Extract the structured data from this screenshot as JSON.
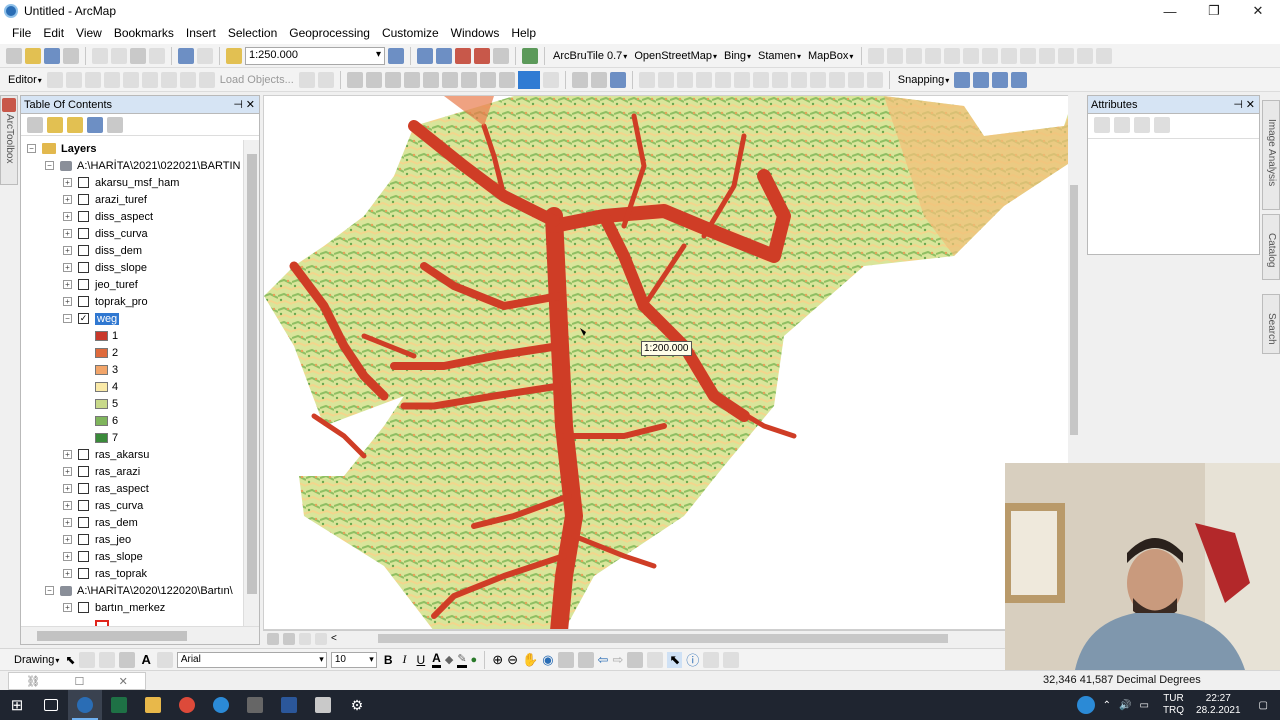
{
  "window": {
    "title": "Untitled - ArcMap",
    "minimize": "—",
    "restore": "❐",
    "close": "✕"
  },
  "menu": [
    "File",
    "Edit",
    "View",
    "Bookmarks",
    "Insert",
    "Selection",
    "Geoprocessing",
    "Customize",
    "Windows",
    "Help"
  ],
  "toolbar": {
    "scale": "1:250.000",
    "arcbrutile": "ArcBruTile 0.7",
    "openstreetmap": "OpenStreetMap",
    "bing": "Bing",
    "stamen": "Stamen",
    "mapbox": "MapBox",
    "editor": "Editor",
    "load_objects": "Load Objects...",
    "snapping": "Snapping"
  },
  "toc": {
    "title": "Table Of Contents",
    "root": "Layers",
    "group1": "A:\\HARİTA\\2021\\022021\\BARTIN",
    "group1_layers": [
      "akarsu_msf_ham",
      "arazi_turef",
      "diss_aspect",
      "diss_curva",
      "diss_dem",
      "diss_slope",
      "jeo_turef",
      "toprak_pro"
    ],
    "selected_layer": "weg",
    "classes": [
      {
        "label": "1",
        "color": "#c9382a"
      },
      {
        "label": "2",
        "color": "#df6a3c"
      },
      {
        "label": "3",
        "color": "#f2a56a"
      },
      {
        "label": "4",
        "color": "#faeaa8"
      },
      {
        "label": "5",
        "color": "#c8d98a"
      },
      {
        "label": "6",
        "color": "#7fb55c"
      },
      {
        "label": "7",
        "color": "#3a8a3a"
      }
    ],
    "group1_layers_after": [
      "ras_akarsu",
      "ras_arazi",
      "ras_aspect",
      "ras_curva",
      "ras_dem",
      "ras_jeo",
      "ras_slope",
      "ras_toprak"
    ],
    "group2": "A:\\HARİTA\\2020\\122020\\Bartın\\",
    "group2_layers": [
      "bartın_merkez"
    ]
  },
  "map": {
    "tooltip": "1:200.000"
  },
  "attributes": {
    "title": "Attributes"
  },
  "side_tabs": {
    "left": "ArcToolbox",
    "right1": "Image Analysis",
    "right2": "Catalog",
    "right3": "Search"
  },
  "drawing": {
    "label": "Drawing",
    "font": "Arial",
    "size": "10",
    "bold": "B",
    "italic": "I",
    "underline": "U",
    "text_tool": "A"
  },
  "status": {
    "coords": "32,346  41,587 Decimal Degrees"
  },
  "taskbar": {
    "lang_top": "TUR",
    "lang_bottom": "TRQ",
    "time": "22:27",
    "date": "28.2.2021"
  }
}
